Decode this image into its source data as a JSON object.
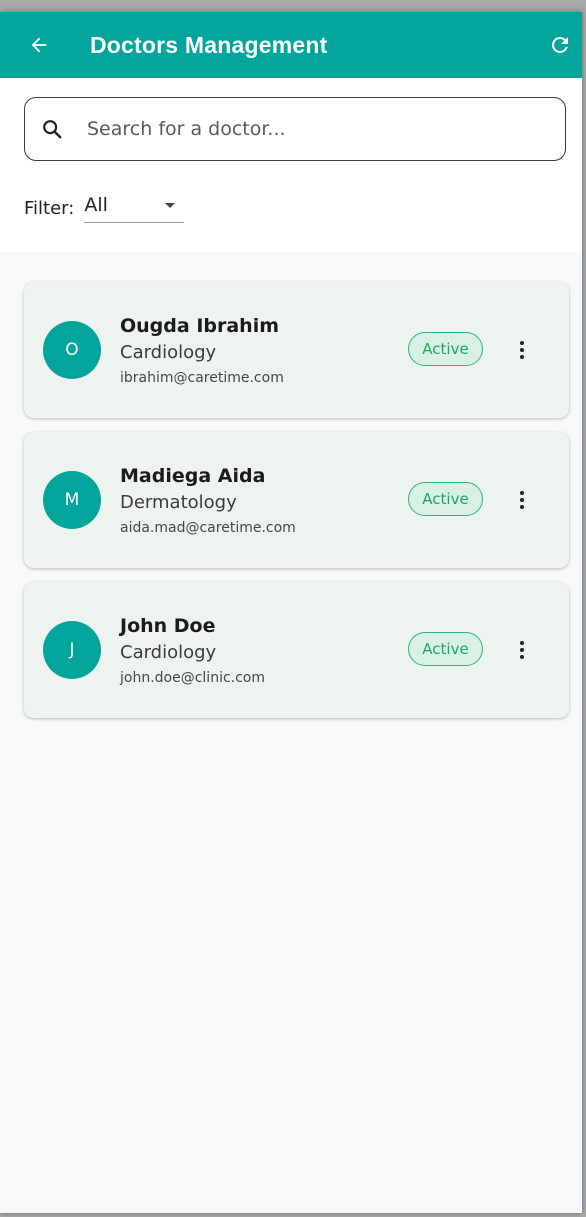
{
  "header": {
    "title": "Doctors Management",
    "back_icon": "arrow-left-icon",
    "refresh_icon": "refresh-icon",
    "bar_color": "#02a59c"
  },
  "search": {
    "placeholder": "Search for a doctor...",
    "value": ""
  },
  "filter": {
    "label": "Filter:",
    "selected": "All"
  },
  "doctors": [
    {
      "initial": "O",
      "name": "Ougda Ibrahim",
      "specialty": "Cardiology",
      "email": "ibrahim@caretime.com",
      "status": "Active"
    },
    {
      "initial": "M",
      "name": "Madiega Aida",
      "specialty": "Dermatology",
      "email": "aida.mad@caretime.com",
      "status": "Active"
    },
    {
      "initial": "J",
      "name": "John Doe",
      "specialty": "Cardiology",
      "email": "john.doe@clinic.com",
      "status": "Active"
    }
  ]
}
